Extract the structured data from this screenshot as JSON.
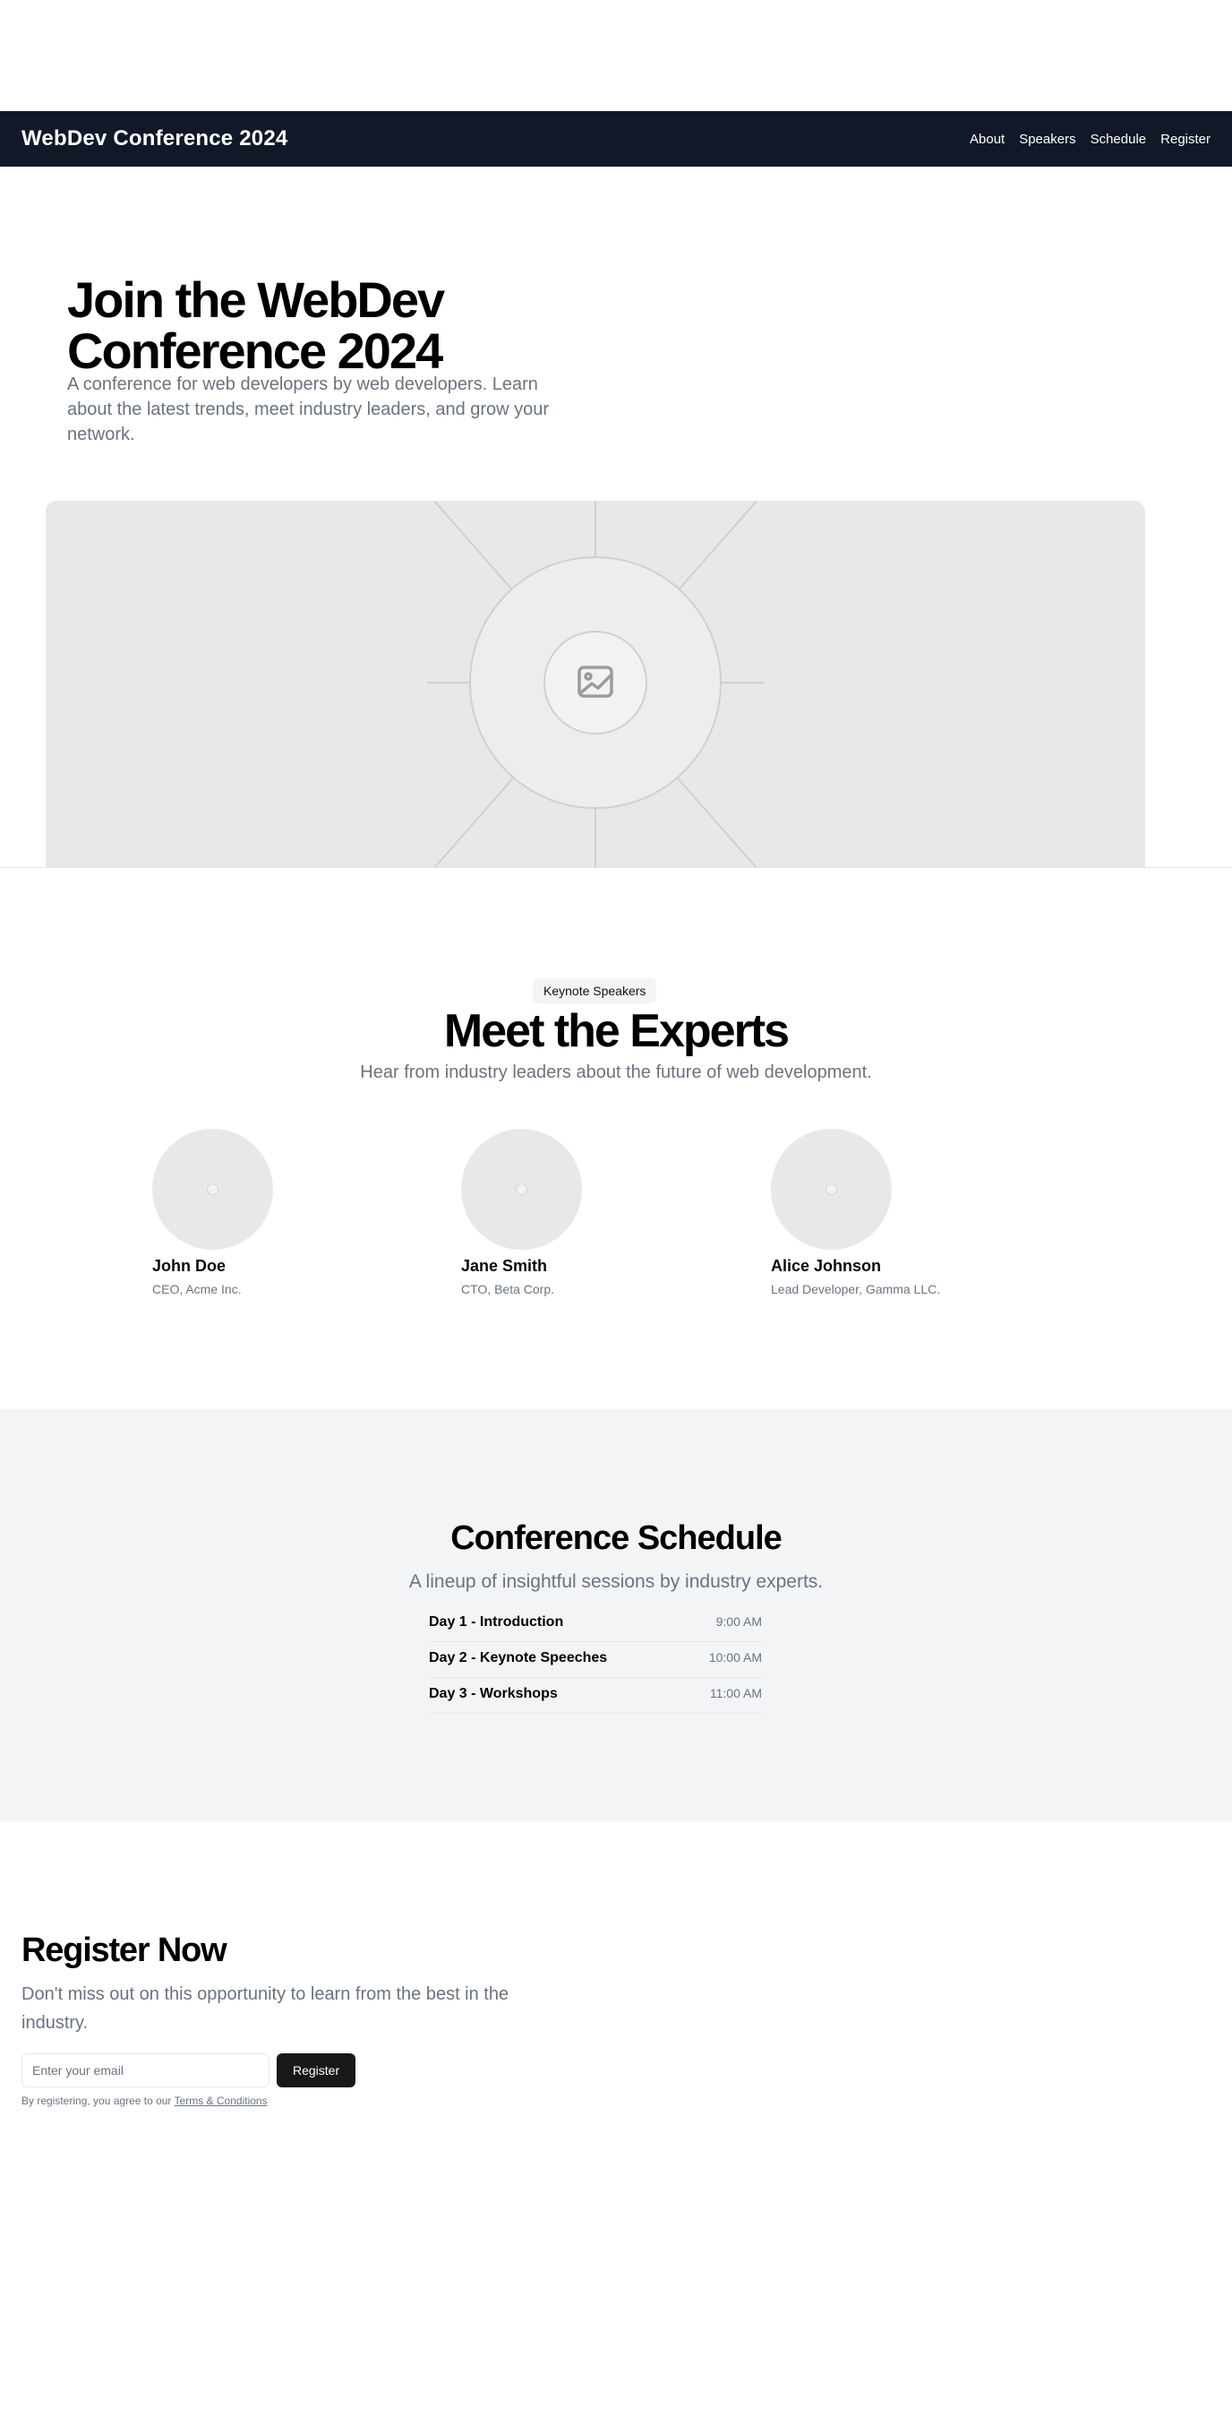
{
  "nav": {
    "brand": "WebDev Conference 2024",
    "links": [
      {
        "label": "About"
      },
      {
        "label": "Speakers"
      },
      {
        "label": "Schedule"
      },
      {
        "label": "Register"
      }
    ]
  },
  "hero": {
    "title": "Join the WebDev Conference 2024",
    "description": "A conference for web developers by web developers. Learn about the latest trends, meet industry leaders, and grow your network.",
    "image_icon": "image-icon"
  },
  "speakers": {
    "badge": "Keynote Speakers",
    "title": "Meet the Experts",
    "subtitle": "Hear from industry leaders about the future of web development.",
    "items": [
      {
        "name": "John Doe",
        "role": "CEO, Acme Inc."
      },
      {
        "name": "Jane Smith",
        "role": "CTO, Beta Corp."
      },
      {
        "name": "Alice Johnson",
        "role": "Lead Developer, Gamma LLC."
      }
    ]
  },
  "schedule": {
    "title": "Conference Schedule",
    "subtitle": "A lineup of insightful sessions by industry experts.",
    "items": [
      {
        "name": "Day 1 - Introduction",
        "time": "9:00 AM"
      },
      {
        "name": "Day 2 - Keynote Speeches",
        "time": "10:00 AM"
      },
      {
        "name": "Day 3 - Workshops",
        "time": "11:00 AM"
      }
    ]
  },
  "register": {
    "title": "Register Now",
    "description": "Don't miss out on this opportunity to learn from the best in the industry.",
    "email_placeholder": "Enter your email",
    "email_value": "",
    "button_label": "Register",
    "terms_prefix": "By registering, you agree to our ",
    "terms_link": "Terms & Conditions"
  },
  "colors": {
    "nav_bg": "#111827",
    "muted_text": "#6b7280",
    "placeholder_bg": "#e8e8e8",
    "section_bg": "#f3f4f6",
    "button_bg": "#18181b"
  }
}
